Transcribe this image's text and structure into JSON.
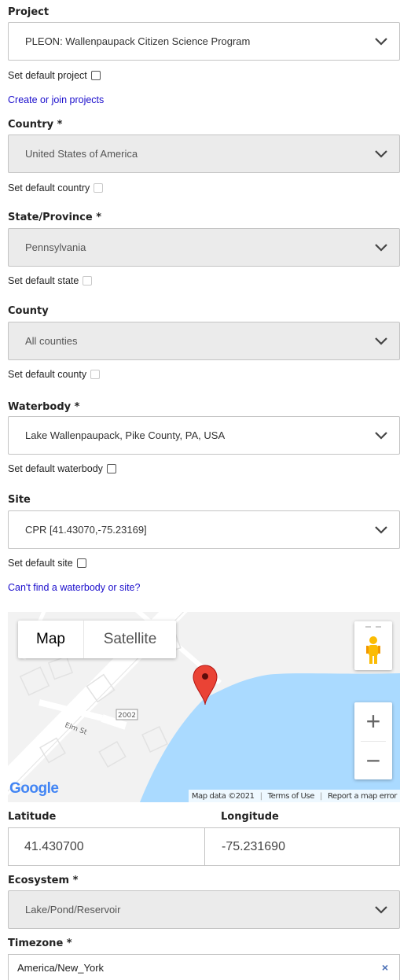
{
  "project": {
    "label": "Project",
    "selected": "PLEON: Wallenpaupack Citizen Science Program",
    "default_label": "Set default project",
    "link": "Create or join projects"
  },
  "country": {
    "label": "Country *",
    "selected": "United States of America",
    "default_label": "Set default country"
  },
  "state": {
    "label": "State/Province *",
    "selected": "Pennsylvania",
    "default_label": "Set default state"
  },
  "county": {
    "label": "County",
    "selected": "All counties",
    "default_label": "Set default county"
  },
  "waterbody": {
    "label": "Waterbody *",
    "selected": "Lake Wallenpaupack, Pike County, PA, USA",
    "default_label": "Set default waterbody"
  },
  "site": {
    "label": "Site",
    "selected": "CPR [41.43070,-75.23169]",
    "default_label": "Set default site",
    "link": "Can't find a waterbody or site?"
  },
  "map": {
    "type_map": "Map",
    "type_satellite": "Satellite",
    "street_label": "Elm St",
    "route_label": "2002",
    "zoom_in": "+",
    "zoom_out": "−",
    "google_logo": "Google",
    "attribution": {
      "data": "Map data ©2021",
      "terms": "Terms of Use",
      "report": "Report a map error"
    },
    "colors": {
      "water": "#aadaff",
      "marker": "#ea4335",
      "land": "#f2f2f2"
    }
  },
  "latitude": {
    "label": "Latitude",
    "value": "41.430700"
  },
  "longitude": {
    "label": "Longitude",
    "value": "-75.231690"
  },
  "ecosystem": {
    "label": "Ecosystem *",
    "selected": "Lake/Pond/Reservoir"
  },
  "timezone": {
    "label": "Timezone *",
    "value": "America/New_York",
    "clear": "×"
  }
}
